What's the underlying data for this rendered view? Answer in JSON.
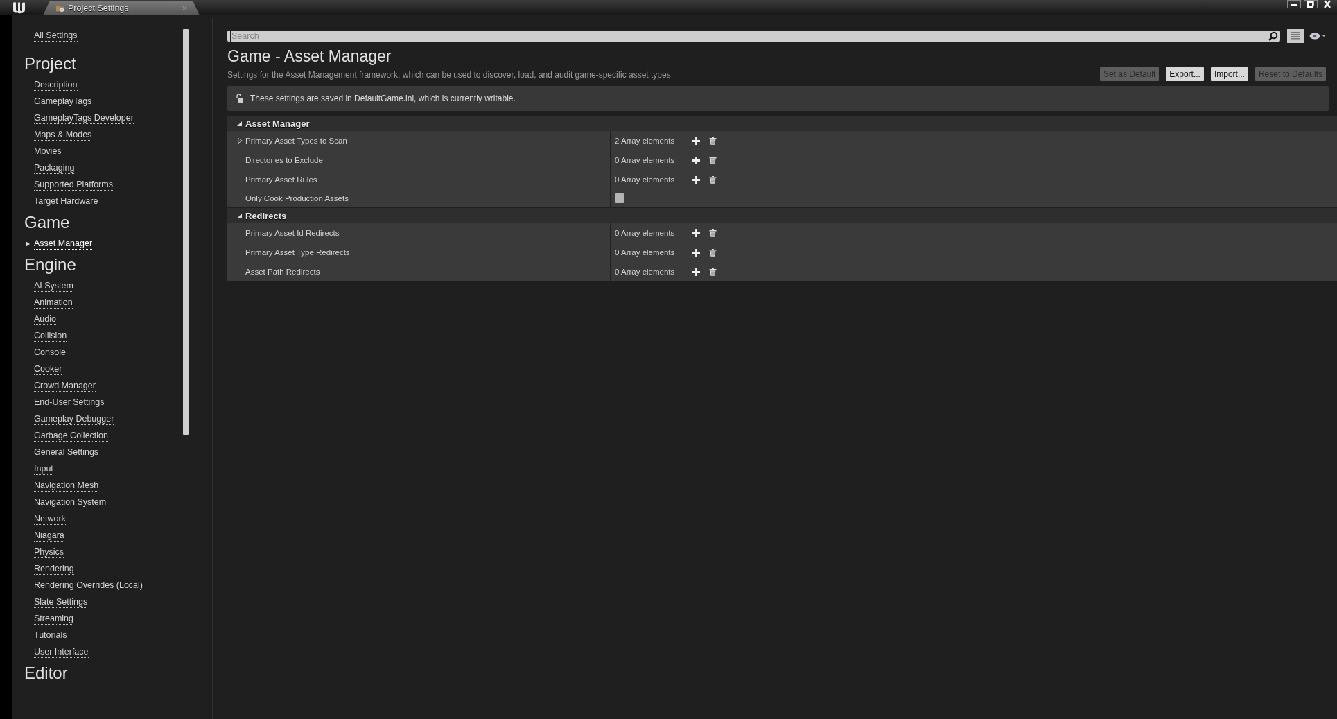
{
  "window": {
    "tab_title": "Project Settings",
    "tab_close": "×"
  },
  "sidebar": {
    "top_link": "All Settings",
    "sections": [
      {
        "title": "Project",
        "items": [
          {
            "label": "Description",
            "selected": false
          },
          {
            "label": "GameplayTags",
            "selected": false
          },
          {
            "label": "GameplayTags Developer",
            "selected": false
          },
          {
            "label": "Maps & Modes",
            "selected": false
          },
          {
            "label": "Movies",
            "selected": false
          },
          {
            "label": "Packaging",
            "selected": false
          },
          {
            "label": "Supported Platforms",
            "selected": false
          },
          {
            "label": "Target Hardware",
            "selected": false
          }
        ]
      },
      {
        "title": "Game",
        "items": [
          {
            "label": "Asset Manager",
            "selected": true
          }
        ]
      },
      {
        "title": "Engine",
        "items": [
          {
            "label": "AI System",
            "selected": false
          },
          {
            "label": "Animation",
            "selected": false
          },
          {
            "label": "Audio",
            "selected": false
          },
          {
            "label": "Collision",
            "selected": false
          },
          {
            "label": "Console",
            "selected": false
          },
          {
            "label": "Cooker",
            "selected": false
          },
          {
            "label": "Crowd Manager",
            "selected": false
          },
          {
            "label": "End-User Settings",
            "selected": false
          },
          {
            "label": "Gameplay Debugger",
            "selected": false
          },
          {
            "label": "Garbage Collection",
            "selected": false
          },
          {
            "label": "General Settings",
            "selected": false
          },
          {
            "label": "Input",
            "selected": false
          },
          {
            "label": "Navigation Mesh",
            "selected": false
          },
          {
            "label": "Navigation System",
            "selected": false
          },
          {
            "label": "Network",
            "selected": false
          },
          {
            "label": "Niagara",
            "selected": false
          },
          {
            "label": "Physics",
            "selected": false
          },
          {
            "label": "Rendering",
            "selected": false
          },
          {
            "label": "Rendering Overrides (Local)",
            "selected": false
          },
          {
            "label": "Slate Settings",
            "selected": false
          },
          {
            "label": "Streaming",
            "selected": false
          },
          {
            "label": "Tutorials",
            "selected": false
          },
          {
            "label": "User Interface",
            "selected": false
          }
        ]
      },
      {
        "title": "Editor"
      }
    ]
  },
  "search": {
    "placeholder": "Search"
  },
  "page": {
    "title": "Game - Asset Manager",
    "description": "Settings for the Asset Management framework, which can be used to discover, load, and audit game-specific asset types",
    "buttons": [
      {
        "label": "Set as Default",
        "disabled": true
      },
      {
        "label": "Export...",
        "disabled": false
      },
      {
        "label": "Import...",
        "disabled": false
      },
      {
        "label": "Reset to Defaults",
        "disabled": true
      }
    ],
    "notice": "These settings are saved in DefaultGame.ini, which is currently writable."
  },
  "categories": [
    {
      "title": "Asset Manager",
      "expanded": true,
      "properties": [
        {
          "kind": "array",
          "name": "Primary Asset Types to Scan",
          "value": "2 Array elements",
          "expanded": false
        },
        {
          "kind": "array",
          "name": "Directories to Exclude",
          "value": "0 Array elements"
        },
        {
          "kind": "array",
          "name": "Primary Asset Rules",
          "value": "0 Array elements"
        },
        {
          "kind": "checkbox",
          "name": "Only Cook Production Assets",
          "checked": false
        }
      ]
    },
    {
      "title": "Redirects",
      "expanded": true,
      "properties": [
        {
          "kind": "array",
          "name": "Primary Asset Id Redirects",
          "value": "0 Array elements"
        },
        {
          "kind": "array",
          "name": "Primary Asset Type Redirects",
          "value": "0 Array elements"
        },
        {
          "kind": "array",
          "name": "Asset Path Redirects",
          "value": "0 Array elements"
        }
      ]
    }
  ]
}
